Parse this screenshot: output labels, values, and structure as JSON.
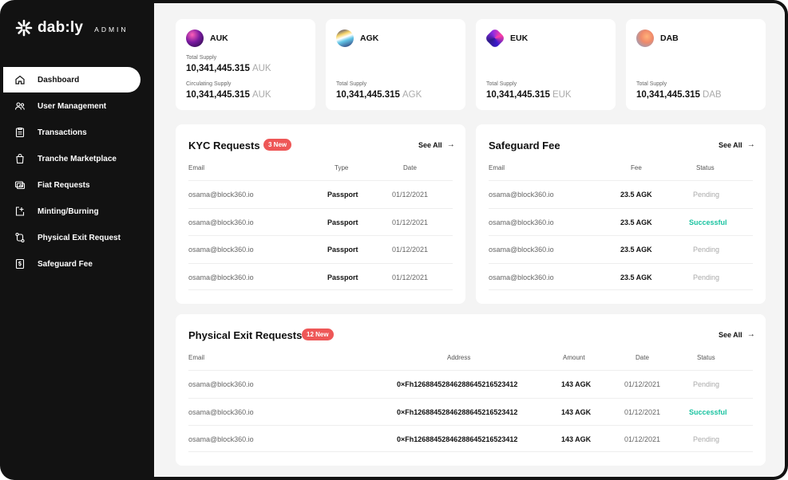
{
  "brand": {
    "name": "dab:ly",
    "tag": "ADMIN"
  },
  "nav": [
    {
      "label": "Dashboard",
      "icon": "home-icon",
      "active": true
    },
    {
      "label": "User Management",
      "icon": "users-icon"
    },
    {
      "label": "Transactions",
      "icon": "clipboard-icon"
    },
    {
      "label": "Tranche Marketplace",
      "icon": "bag-icon"
    },
    {
      "label": "Fiat Requests",
      "icon": "cash-icon"
    },
    {
      "label": "Minting/Burning",
      "icon": "mint-icon"
    },
    {
      "label": "Physical Exit Request",
      "icon": "route-icon"
    },
    {
      "label": "Safeguard Fee",
      "icon": "dollar-doc-icon"
    }
  ],
  "tokens": [
    {
      "symbol": "AUK",
      "total_label": "Total Supply",
      "total_value": "10,341,445.315",
      "unit": "AUK",
      "circ_label": "Circulating Supply",
      "circ_value": "10,341,445.315",
      "circ_unit": "AUK"
    },
    {
      "symbol": "AGK",
      "total_label": "Total Supply",
      "total_value": "10,341,445.315",
      "unit": "AGK"
    },
    {
      "symbol": "EUK",
      "total_label": "Total Supply",
      "total_value": "10,341,445.315",
      "unit": "EUK"
    },
    {
      "symbol": "DAB",
      "total_label": "Total Supply",
      "total_value": "10,341,445.315",
      "unit": "DAB"
    }
  ],
  "kyc": {
    "title": "KYC Requests",
    "badge": "3 New",
    "see_all": "See All",
    "headers": {
      "email": "Email",
      "type": "Type",
      "date": "Date"
    },
    "rows": [
      {
        "email": "osama@block360.io",
        "type": "Passport",
        "date": "01/12/2021"
      },
      {
        "email": "osama@block360.io",
        "type": "Passport",
        "date": "01/12/2021"
      },
      {
        "email": "osama@block360.io",
        "type": "Passport",
        "date": "01/12/2021"
      },
      {
        "email": "osama@block360.io",
        "type": "Passport",
        "date": "01/12/2021"
      }
    ]
  },
  "safeguard": {
    "title": "Safeguard Fee",
    "see_all": "See All",
    "headers": {
      "email": "Email",
      "fee": "Fee",
      "status": "Status"
    },
    "rows": [
      {
        "email": "osama@block360.io",
        "fee": "23.5 AGK",
        "status": "Pending"
      },
      {
        "email": "osama@block360.io",
        "fee": "23.5 AGK",
        "status": "Successful"
      },
      {
        "email": "osama@block360.io",
        "fee": "23.5 AGK",
        "status": "Pending"
      },
      {
        "email": "osama@block360.io",
        "fee": "23.5 AGK",
        "status": "Pending"
      }
    ]
  },
  "exits": {
    "title": "Physical Exit Requests",
    "badge": "12 New",
    "see_all": "See All",
    "headers": {
      "email": "Email",
      "address": "Address",
      "amount": "Amount",
      "date": "Date",
      "status": "Status"
    },
    "rows": [
      {
        "email": "osama@block360.io",
        "address": "0×Fh126884528462886452165234​12",
        "amount": "143 AGK",
        "date": "01/12/2021",
        "status": "Pending"
      },
      {
        "email": "osama@block360.io",
        "address": "0×Fh12688452846288645216523412",
        "amount": "143 AGK",
        "date": "01/12/2021",
        "status": "Successful"
      },
      {
        "email": "osama@block360.io",
        "address": "0×Fh12688452846288645216523412",
        "amount": "143 AGK",
        "date": "01/12/2021",
        "status": "Pending"
      }
    ]
  },
  "colors": {
    "accent_red": "#ee5757",
    "success": "#19c3a0",
    "sidebar": "#121212",
    "background": "#f4f4f4"
  }
}
